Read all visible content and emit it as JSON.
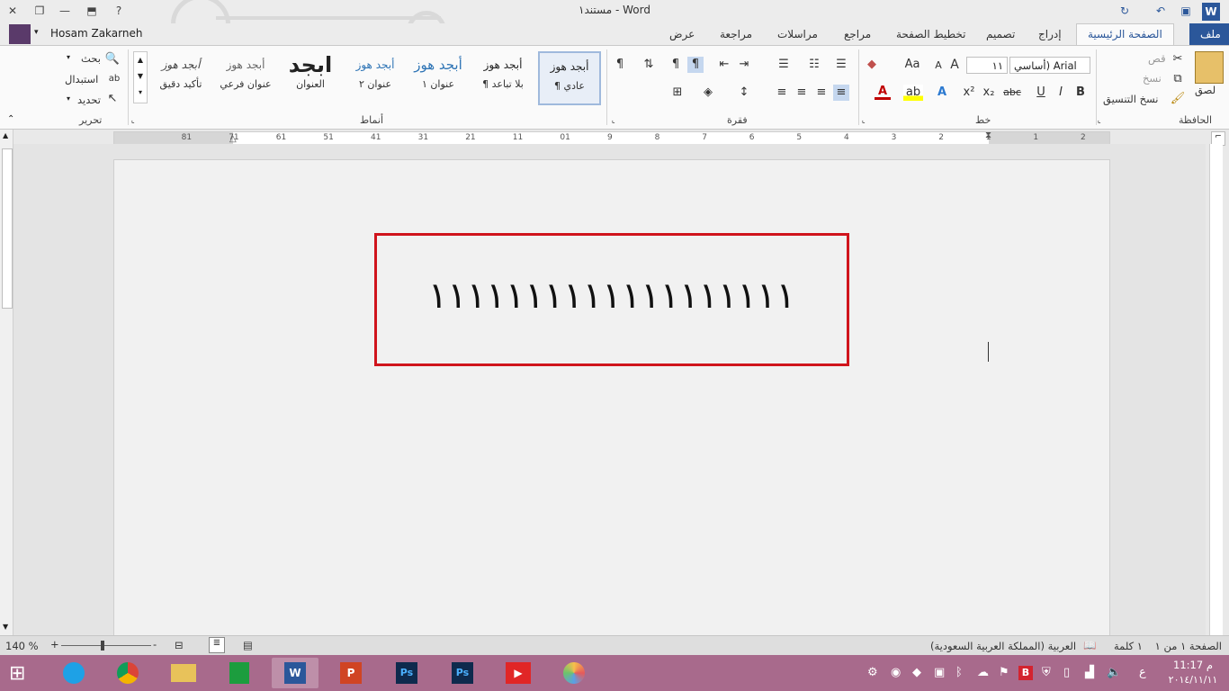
{
  "app": {
    "window_title": "مستند١ - Word",
    "user_name": "Hosam Zakarneh"
  },
  "tabs": [
    {
      "label": "ملف"
    },
    {
      "label": "الصفحة الرئيسية"
    },
    {
      "label": "إدراج"
    },
    {
      "label": "تصميم"
    },
    {
      "label": "تخطيط الصفحة"
    },
    {
      "label": "مراجع"
    },
    {
      "label": "مراسلات"
    },
    {
      "label": "مراجعة"
    },
    {
      "label": "عرض"
    }
  ],
  "clipboard": {
    "group": "الحافظة",
    "paste": "لصق",
    "cut": "قص",
    "copy": "نسخ",
    "format_painter": "نسخ التنسيق"
  },
  "font": {
    "group": "خط",
    "font_name": "أساسي) Arial",
    "font_size": "١١",
    "change_case": "Aa",
    "bold": "B",
    "italic": "I",
    "underline": "U",
    "strike": "abc",
    "subscript": "x₂",
    "superscript": "x²",
    "grow": "A",
    "shrink": "A",
    "text_effects": "A",
    "highlight": "ab",
    "font_color": "A"
  },
  "paragraph": {
    "group": "فقرة",
    "pilcrow": "¶"
  },
  "styles": {
    "group": "أنماط",
    "items": [
      {
        "preview": "أبجد هوز",
        "name": "¶ عادي"
      },
      {
        "preview": "أبجد هوز",
        "name": "¶ بلا تباعد"
      },
      {
        "preview": "أبجد هوز",
        "name": "عنوان ١"
      },
      {
        "preview": "أبجد هوز",
        "name": "عنوان ٢"
      },
      {
        "preview": "ابجد",
        "name": "العنوان"
      },
      {
        "preview": "أبجد هوز",
        "name": "عنوان فرعي"
      },
      {
        "preview": "أبجد هوز",
        "name": "تأكيد دقيق"
      }
    ]
  },
  "editing": {
    "group": "تحرير",
    "find": "بحث",
    "replace": "استبدال",
    "select": "تحديد"
  },
  "ruler": {
    "numbers": [
      "2",
      "1",
      "1",
      "2",
      "3",
      "4",
      "5",
      "6",
      "7",
      "8",
      "9",
      "01",
      "11",
      "21",
      "31",
      "41",
      "51",
      "61",
      "71",
      "81"
    ]
  },
  "document": {
    "text": "١١١١١١١١١١١١١١١١١١١"
  },
  "status": {
    "page": "الصفحة ١ من ١",
    "words": "١ كلمة",
    "language": "العربية (المملكة العربية السعودية)",
    "zoom": "140 %",
    "zoom_minus": "-",
    "zoom_plus": "+"
  },
  "tray": {
    "time": "11:17 م",
    "date": "٢٠١٤/١١/١١",
    "lang": "ع"
  },
  "colors": {
    "accent": "#2b579a",
    "red_box": "#d0141c",
    "taskbar": "#a86a8c"
  }
}
